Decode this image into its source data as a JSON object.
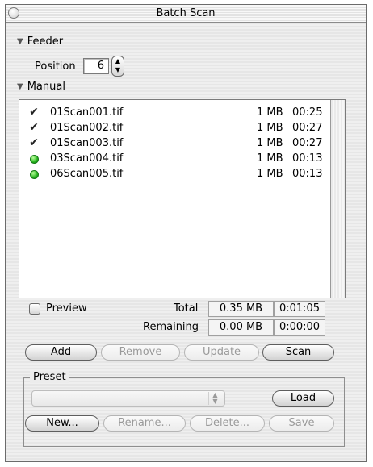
{
  "window": {
    "title": "Batch Scan"
  },
  "feeder": {
    "label": "Feeder",
    "position_label": "Position",
    "position_value": "6"
  },
  "manual": {
    "label": "Manual"
  },
  "files": [
    {
      "status": "done",
      "name": "01Scan001.tif",
      "size": "1 MB",
      "time": "00:25"
    },
    {
      "status": "done",
      "name": "01Scan002.tif",
      "size": "1 MB",
      "time": "00:27"
    },
    {
      "status": "done",
      "name": "01Scan003.tif",
      "size": "1 MB",
      "time": "00:27"
    },
    {
      "status": "pending",
      "name": "03Scan004.tif",
      "size": "1 MB",
      "time": "00:13"
    },
    {
      "status": "pending",
      "name": "06Scan005.tif",
      "size": "1 MB",
      "time": "00:13"
    }
  ],
  "summary": {
    "preview_label": "Preview",
    "total_label": "Total",
    "total_size": "0.35 MB",
    "total_time": "0:01:05",
    "remaining_label": "Remaining",
    "remaining_size": "0.00 MB",
    "remaining_time": "0:00:00"
  },
  "buttons": {
    "add": "Add",
    "remove": "Remove",
    "update": "Update",
    "scan": "Scan"
  },
  "preset": {
    "title": "Preset",
    "load": "Load",
    "new": "New...",
    "rename": "Rename...",
    "delete": "Delete...",
    "save": "Save"
  },
  "icons": {
    "done": "checkmark-icon",
    "pending": "green-dot-icon"
  }
}
